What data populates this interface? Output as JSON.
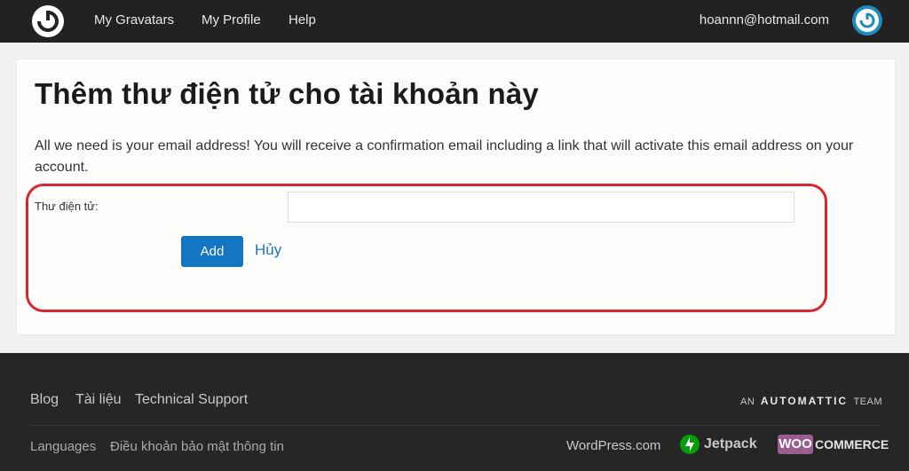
{
  "header": {
    "nav": [
      "My Gravatars",
      "My Profile",
      "Help"
    ],
    "user_email": "hoannn@hotmail.com"
  },
  "main": {
    "title": "Thêm thư điện tử cho tài khoản này",
    "description": "All we need is your email address! You will receive a confirmation email including a link that will activate this email address on your account.",
    "field_label": "Thư điện tử:",
    "email_value": "",
    "add_label": "Add",
    "cancel_label": "Hủy",
    "highlight_color": "#d7262e"
  },
  "footer": {
    "links_top": [
      "Blog",
      "Tài liệu",
      "Technical Support"
    ],
    "links_bottom": [
      "Languages",
      "Điều khoản bảo mật thông tin"
    ],
    "automattic": {
      "prefix": "AN",
      "brand": "AUTOMATTIC",
      "suffix": "TEAM"
    },
    "wordpress": "WordPress.com",
    "jetpack": "Jetpack",
    "woo": {
      "mark": "WOO",
      "text": "COMMERCE"
    }
  },
  "colors": {
    "topbar": "#222222",
    "primary": "#1476c2",
    "footer": "#262626"
  }
}
